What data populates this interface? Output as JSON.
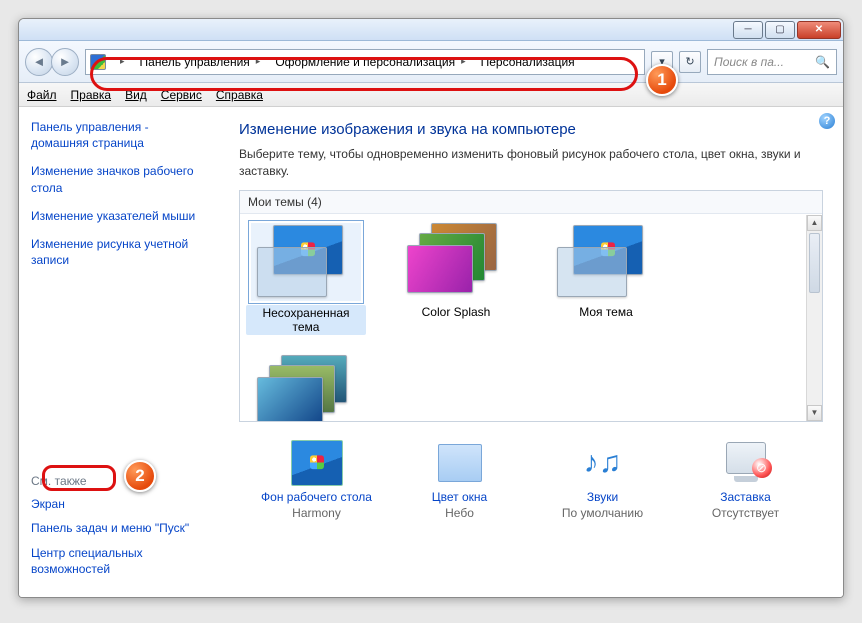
{
  "breadcrumb": {
    "seg1": "Панель управления",
    "seg2": "Оформление и персонализация",
    "seg3": "Персонализация"
  },
  "search": {
    "placeholder": "Поиск в па..."
  },
  "menu": {
    "file": "Файл",
    "edit": "Правка",
    "view": "Вид",
    "service": "Сервис",
    "help": "Справка"
  },
  "sidebar": {
    "home": "Панель управления - домашняя страница",
    "icons": "Изменение значков рабочего стола",
    "pointers": "Изменение указателей мыши",
    "account_pic": "Изменение рисунка учетной записи",
    "see_also_title": "См. также",
    "screen": "Экран",
    "taskbar": "Панель задач и меню \"Пуск\"",
    "ease": "Центр специальных возможностей"
  },
  "content": {
    "title": "Изменение изображения и звука на компьютере",
    "desc": "Выберите тему, чтобы одновременно изменить фоновый рисунок рабочего стола, цвет окна, звуки и заставку.",
    "my_themes": "Мои темы (4)"
  },
  "themes": {
    "t1": "Несохраненная тема",
    "t2": "Color Splash",
    "t3": "Моя тема"
  },
  "bottom": {
    "bg": {
      "label": "Фон рабочего стола",
      "value": "Harmony"
    },
    "color": {
      "label": "Цвет окна",
      "value": "Небо"
    },
    "sounds": {
      "label": "Звуки",
      "value": "По умолчанию"
    },
    "saver": {
      "label": "Заставка",
      "value": "Отсутствует"
    }
  },
  "badges": {
    "b1": "1",
    "b2": "2"
  }
}
